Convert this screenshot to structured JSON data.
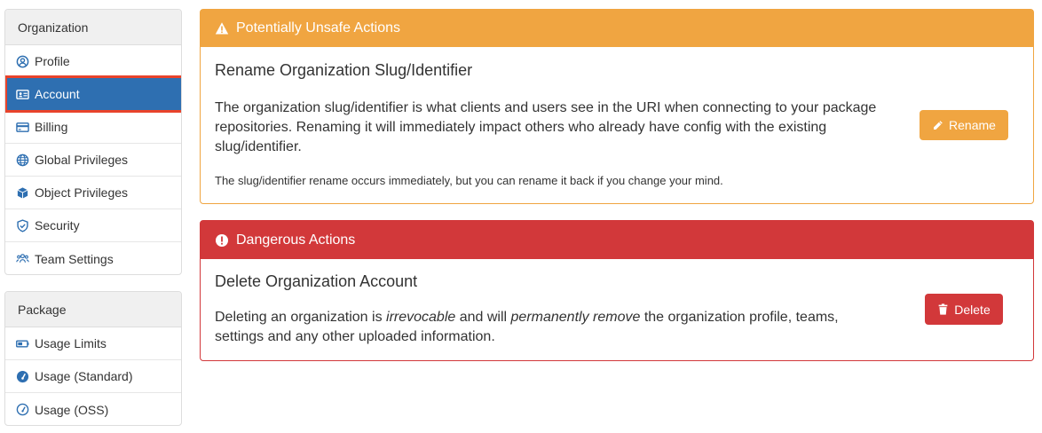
{
  "sidebar": {
    "org_header": "Organization",
    "org_items": [
      {
        "label": "Profile",
        "icon": "user-circle-icon"
      },
      {
        "label": "Account",
        "icon": "id-card-icon",
        "active": true
      },
      {
        "label": "Billing",
        "icon": "credit-card-icon"
      },
      {
        "label": "Global Privileges",
        "icon": "globe-icon"
      },
      {
        "label": "Object Privileges",
        "icon": "cube-icon"
      },
      {
        "label": "Security",
        "icon": "shield-icon"
      },
      {
        "label": "Team Settings",
        "icon": "users-icon"
      }
    ],
    "pkg_header": "Package",
    "pkg_items": [
      {
        "label": "Usage Limits",
        "icon": "battery-icon"
      },
      {
        "label": "Usage (Standard)",
        "icon": "tachometer-icon"
      },
      {
        "label": "Usage (OSS)",
        "icon": "tachometer-outline-icon"
      }
    ]
  },
  "unsafe": {
    "header": "Potentially Unsafe Actions",
    "title": "Rename Organization Slug/Identifier",
    "description": "The organization slug/identifier is what clients and users see in the URI when connecting to your package repositories. Renaming it will immediately impact others who already have config with the existing slug/identifier.",
    "note": "The slug/identifier rename occurs immediately, but you can rename it back if you change your mind.",
    "button": "Rename"
  },
  "danger": {
    "header": "Dangerous Actions",
    "title": "Delete Organization Account",
    "desc_part1": "Deleting an organization is ",
    "desc_em1": "irrevocable",
    "desc_part2": " and will ",
    "desc_em2": "permanently remove",
    "desc_part3": " the organization profile, teams, settings and any other uploaded information.",
    "button": "Delete"
  },
  "colors": {
    "active": "#2e6fb1",
    "warning": "#f0a541",
    "danger": "#d2383a",
    "highlight": "#e8432b"
  }
}
